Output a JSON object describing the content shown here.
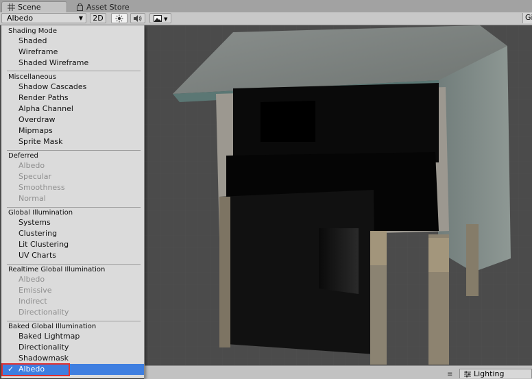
{
  "tabs": [
    {
      "label": "Scene",
      "icon": "grid-icon",
      "active": true
    },
    {
      "label": "Asset Store",
      "icon": "store-bag-icon",
      "active": false
    }
  ],
  "toolbar": {
    "draw_mode": "Albedo",
    "btn_2d": "2D",
    "lighting_icon": "sun-icon",
    "audio_icon": "speaker-icon",
    "effects_icon": "image-icon",
    "gizmos": "Gi"
  },
  "menu": {
    "shading_mode": {
      "title": "Shading Mode",
      "items": [
        "Shaded",
        "Wireframe",
        "Shaded Wireframe"
      ]
    },
    "miscellaneous": {
      "title": "Miscellaneous",
      "items": [
        "Shadow Cascades",
        "Render Paths",
        "Alpha Channel",
        "Overdraw",
        "Mipmaps",
        "Sprite Mask"
      ]
    },
    "deferred": {
      "title": "Deferred",
      "items": [
        "Albedo",
        "Specular",
        "Smoothness",
        "Normal"
      ]
    },
    "global_illumination": {
      "title": "Global Illumination",
      "items": [
        "Systems",
        "Clustering",
        "Lit Clustering",
        "UV Charts"
      ]
    },
    "realtime_gi": {
      "title": "Realtime Global Illumination",
      "items": [
        "Albedo",
        "Emissive",
        "Indirect",
        "Directionality"
      ]
    },
    "baked_gi": {
      "title": "Baked Global Illumination",
      "items": [
        "Baked Lightmap",
        "Directionality",
        "Shadowmask",
        "Albedo"
      ]
    },
    "selected_check": "✓"
  },
  "bottom": {
    "lighting_tab": "Lighting",
    "lighting_icon": "sliders-icon"
  },
  "colors": {
    "selection": "#3e7ee0",
    "highlight": "#e03030",
    "menu_bg": "#dbdbdb"
  }
}
